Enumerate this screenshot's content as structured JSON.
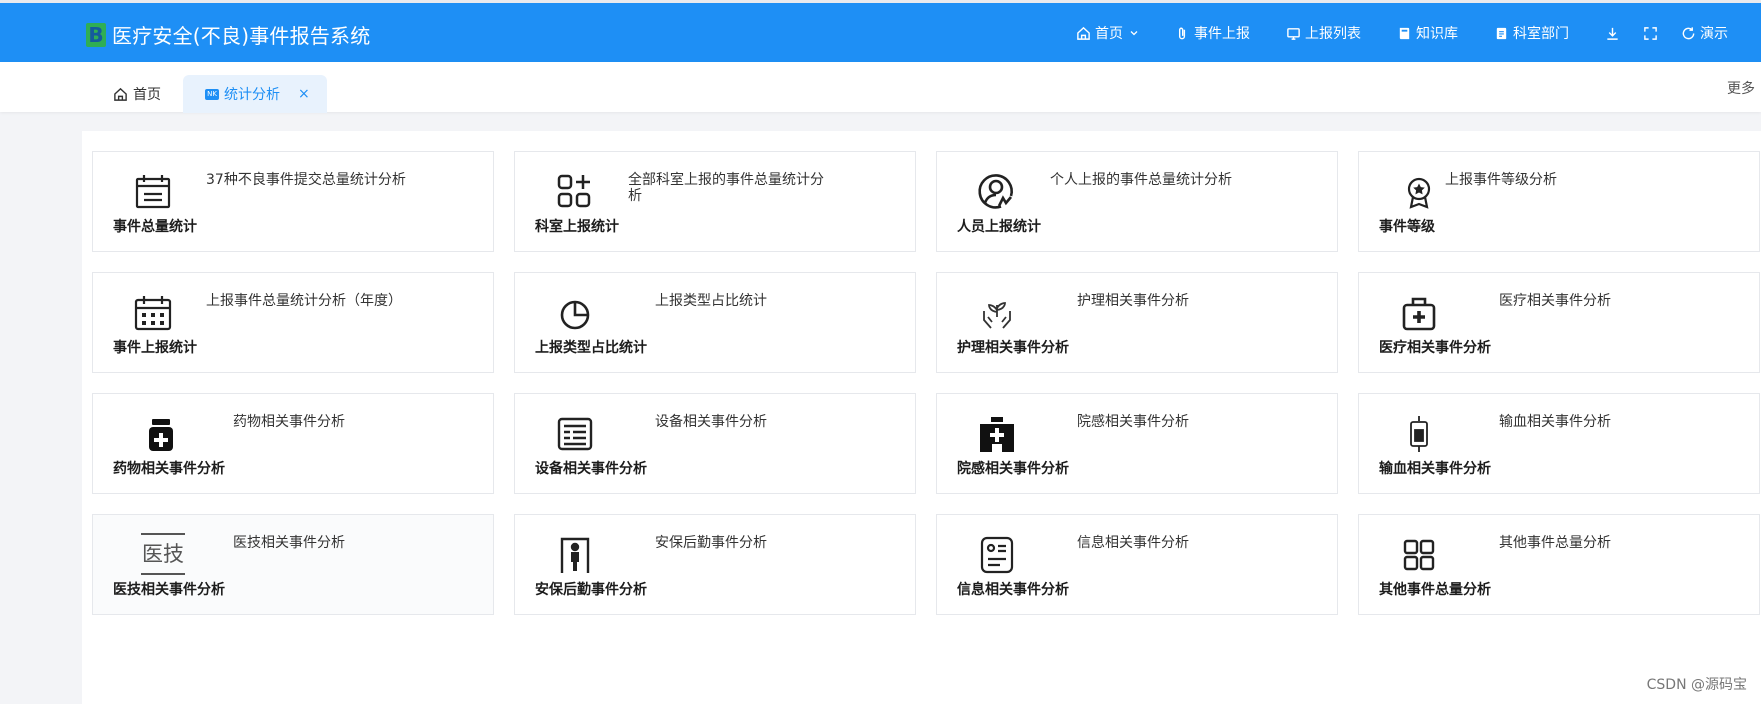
{
  "header": {
    "logo_letter": "B",
    "app_title": "医疗安全(不良)事件报告系统",
    "nav": [
      {
        "icon": "home-icon",
        "label": "首页"
      },
      {
        "icon": "paperclip-icon",
        "label": "事件上报"
      },
      {
        "icon": "monitor-icon",
        "label": "上报列表"
      },
      {
        "icon": "book-icon",
        "label": "知识库"
      },
      {
        "icon": "clipboard-icon",
        "label": "科室部门"
      }
    ],
    "refresh_label": "演示"
  },
  "tabs": {
    "home_label": "首页",
    "active_label": "统计分析",
    "active_icon_text": "NK",
    "close_glyph": "×",
    "more_label": "更多"
  },
  "cards": [
    {
      "title": "事件总量统计",
      "desc": "37种不良事件提交总量统计分析",
      "icon": "calendar-list-icon"
    },
    {
      "title": "科室上报统计",
      "desc": "全部科室上报的事件总量统计分析",
      "icon": "apps-add-icon"
    },
    {
      "title": "人员上报统计",
      "desc": "个人上报的事件总量统计分析",
      "icon": "user-circle-icon"
    },
    {
      "title": "事件等级",
      "desc": "上报事件等级分析",
      "icon": "medal-icon"
    },
    {
      "title": "事件上报统计",
      "desc": "上报事件总量统计分析（年度）",
      "icon": "calendar-grid-icon"
    },
    {
      "title": "上报类型占比统计",
      "desc": "上报类型占比统计",
      "icon": "pie-chart-icon"
    },
    {
      "title": "护理相关事件分析",
      "desc": "护理相关事件分析",
      "icon": "hands-plant-icon"
    },
    {
      "title": "医疗相关事件分析",
      "desc": "医疗相关事件分析",
      "icon": "medical-kit-icon"
    },
    {
      "title": "药物相关事件分析",
      "desc": "药物相关事件分析",
      "icon": "medicine-bottle-icon"
    },
    {
      "title": "设备相关事件分析",
      "desc": "设备相关事件分析",
      "icon": "device-list-icon"
    },
    {
      "title": "院感相关事件分析",
      "desc": "院感相关事件分析",
      "icon": "hospital-icon"
    },
    {
      "title": "输血相关事件分析",
      "desc": "输血相关事件分析",
      "icon": "blood-bag-icon"
    },
    {
      "title": "医技相关事件分析",
      "desc": "医技相关事件分析",
      "icon": "medical-tech-icon",
      "icon_text": "医技"
    },
    {
      "title": "安保后勤事件分析",
      "desc": "安保后勤事件分析",
      "icon": "security-gate-icon"
    },
    {
      "title": "信息相关事件分析",
      "desc": "信息相关事件分析",
      "icon": "info-card-icon"
    },
    {
      "title": "其他事件总量分析",
      "desc": "其他事件总量分析",
      "icon": "grid-apps-icon"
    }
  ],
  "watermark": "CSDN @源码宝",
  "colors": {
    "primary": "#1e8ff5",
    "logo_green": "#2fae55"
  }
}
